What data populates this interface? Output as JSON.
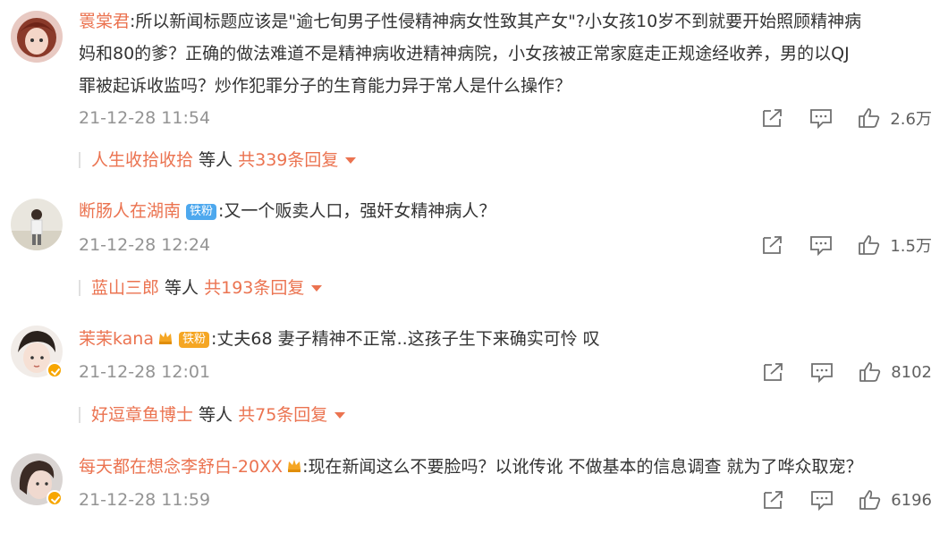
{
  "comments": [
    {
      "username": "瞏棠君",
      "text_line1": ":所以新闻标题应该是\"逾七旬男子性侵精神病女性致其产女\"?小女孩10岁不到就要开始照顾精神病",
      "text_line2": "妈和80的爹？正确的做法难道不是精神病收进精神病院，小女孩被正常家庭走正规途经收养，男的以QJ",
      "text_line3": "罪被起诉收监吗？炒作犯罪分子的生育能力异于常人是什么操作？",
      "time": "21-12-28 11:54",
      "likes": "2.6万",
      "reply_user": "人生收拾收拾",
      "reply_mid": " 等人 ",
      "reply_total": "共339条回复"
    },
    {
      "username": "断肠人在湖南",
      "badge": "铁粉",
      "text_line1": ":又一个贩卖人口，强奸女精神病人？",
      "time": "21-12-28 12:24",
      "likes": "1.5万",
      "reply_user": "蓝山三郎",
      "reply_mid": " 等人 ",
      "reply_total": "共193条回复"
    },
    {
      "username": "茉茉kana",
      "badge": "铁粉",
      "text_line1": ":丈夫68 妻子精神不正常..这孩子生下来确实可怜 叹",
      "time": "21-12-28 12:01",
      "likes": "8102",
      "reply_user": "好逗章鱼博士",
      "reply_mid": " 等人 ",
      "reply_total": "共75条回复"
    },
    {
      "username": "每天都在想念李舒白-20XX",
      "text_line1": ":现在新闻这么不要脸吗？以讹传讹 不做基本的信息调查 就为了哗众取宠？",
      "time": "21-12-28 11:59",
      "likes": "6196"
    }
  ],
  "colors": {
    "username": "#eb7350",
    "timestamp": "#939393",
    "text": "#333333"
  },
  "icons": [
    "share-icon",
    "comment-icon",
    "like-icon",
    "crown-icon",
    "verified-icon",
    "caret-down-icon"
  ]
}
